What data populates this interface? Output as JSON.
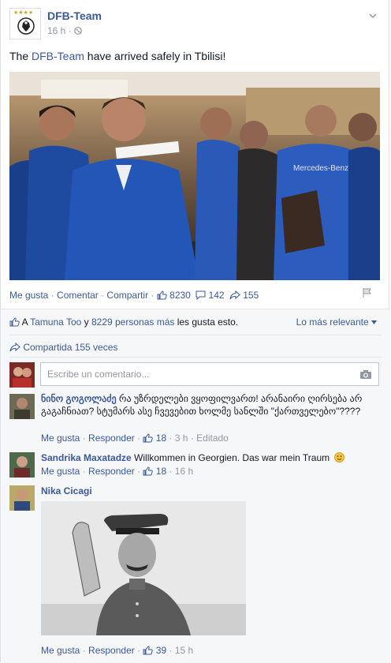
{
  "post": {
    "page_name": "DFB-Team",
    "time": "16 h",
    "meta_sep": "·",
    "text_before": "The ",
    "text_link": "DFB-Team",
    "text_after": " have arrived safely in Tbilisi!",
    "jersey_text": "Mercedes-Benz"
  },
  "actions": {
    "like": "Me gusta",
    "comment": "Comentar",
    "share": "Compartir",
    "sep": "·",
    "likes_count": "8230",
    "comments_count": "142",
    "shares_count": "155"
  },
  "likes_summary": {
    "prefix": "A ",
    "name": "Tamuna Too",
    "middle": " y ",
    "others": "8229 personas más",
    "suffix": " les gusta esto.",
    "sort_label": "Lo más relevante"
  },
  "shares_line": "Compartida 155 veces",
  "comment_input": {
    "placeholder": "Escribe un comentario..."
  },
  "comments": [
    {
      "name": "ნინო გოგოლაძე",
      "text": " რა უზრდელები ვყოფილვართ! არანაირი ღირსება არ გაგაჩნიათ? სტუმარს ასე ჩვევებით ხოლმე სანლში \"ქართველებო\"????",
      "like": "Me gusta",
      "reply": "Responder",
      "likes": "18",
      "time": "3 h",
      "edited": "Editado"
    },
    {
      "name": "Sandrika Maxatadze",
      "text": " Willkommen in Georgien. Das war mein Traum",
      "like": "Me gusta",
      "reply": "Responder",
      "likes": "18",
      "time": "16 h"
    },
    {
      "name": "Nika Cicagi",
      "like": "Me gusta",
      "reply": "Responder",
      "likes": "39",
      "time": "15 h"
    }
  ],
  "colors": {
    "link": "#3b5998",
    "muted": "#9197a3",
    "bg_gray": "#f6f7f8"
  }
}
